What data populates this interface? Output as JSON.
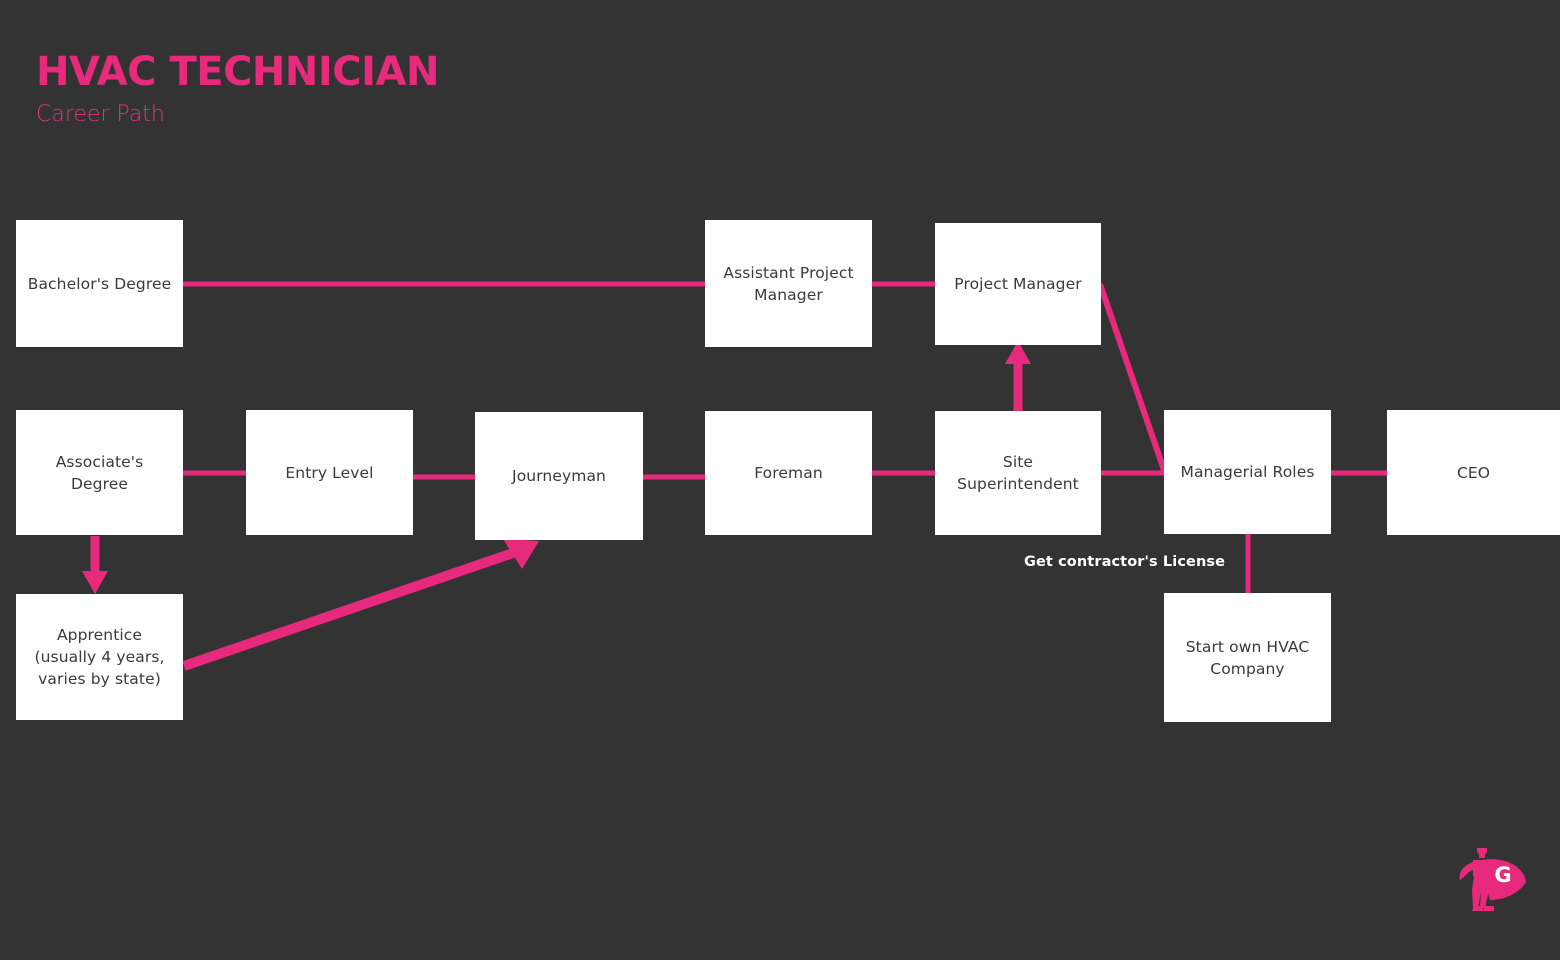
{
  "header": {
    "title": "HVAC TECHNICIAN",
    "subtitle": "Career Path"
  },
  "colors": {
    "background": "#333333",
    "accent_pink": "#E82A7C",
    "node_fill": "#FFFFFF",
    "node_text": "#3A3A3A",
    "caption_text": "#FFFFFF"
  },
  "nodes": [
    {
      "id": "bachelors",
      "label": "Bachelor's Degree"
    },
    {
      "id": "assistant-pm",
      "label": "Assistant Project\nManager"
    },
    {
      "id": "project-manager",
      "label": "Project Manager"
    },
    {
      "id": "associates",
      "label": "Associate's Degree"
    },
    {
      "id": "entry-level",
      "label": "Entry Level"
    },
    {
      "id": "journeyman",
      "label": "Journeyman"
    },
    {
      "id": "foreman",
      "label": "Foreman"
    },
    {
      "id": "site-super",
      "label": "Site\nSuperintendent"
    },
    {
      "id": "managerial",
      "label": "Managerial Roles"
    },
    {
      "id": "ceo",
      "label": "CEO"
    },
    {
      "id": "apprentice",
      "label": "Apprentice\n(usually 4 years,\nvaries by state)"
    },
    {
      "id": "own-company",
      "label": "Start own HVAC\nCompany"
    }
  ],
  "edge_captions": [
    {
      "id": "contractor-license",
      "label": "Get contractor's License"
    }
  ],
  "logo": {
    "monogram": "G",
    "name": "superhero-logo"
  },
  "chart_data": {
    "type": "diagram",
    "title": "HVAC TECHNICIAN Career Path",
    "nodes": [
      "Bachelor's Degree",
      "Assistant Project Manager",
      "Project Manager",
      "Associate's Degree",
      "Entry Level",
      "Journeyman",
      "Foreman",
      "Site Superintendent",
      "Managerial Roles",
      "CEO",
      "Apprentice (usually 4 years, varies by state)",
      "Start own HVAC Company"
    ],
    "edges": [
      {
        "from": "Bachelor's Degree",
        "to": "Assistant Project Manager",
        "style": "line"
      },
      {
        "from": "Assistant Project Manager",
        "to": "Project Manager",
        "style": "line"
      },
      {
        "from": "Associate's Degree",
        "to": "Entry Level",
        "style": "line"
      },
      {
        "from": "Associate's Degree",
        "to": "Apprentice (usually 4 years, varies by state)",
        "style": "arrow-down"
      },
      {
        "from": "Apprentice (usually 4 years, varies by state)",
        "to": "Journeyman",
        "style": "arrow-diagonal"
      },
      {
        "from": "Entry Level",
        "to": "Journeyman",
        "style": "line"
      },
      {
        "from": "Journeyman",
        "to": "Foreman",
        "style": "line"
      },
      {
        "from": "Foreman",
        "to": "Site Superintendent",
        "style": "line"
      },
      {
        "from": "Site Superintendent",
        "to": "Project Manager",
        "style": "arrow-up"
      },
      {
        "from": "Site Superintendent",
        "to": "Managerial Roles",
        "style": "line"
      },
      {
        "from": "Project Manager",
        "to": "Managerial Roles",
        "style": "line-diagonal"
      },
      {
        "from": "Managerial Roles",
        "to": "CEO",
        "style": "line"
      },
      {
        "from": "Managerial Roles",
        "to": "Start own HVAC Company",
        "style": "line",
        "label": "Get contractor's License"
      }
    ]
  }
}
